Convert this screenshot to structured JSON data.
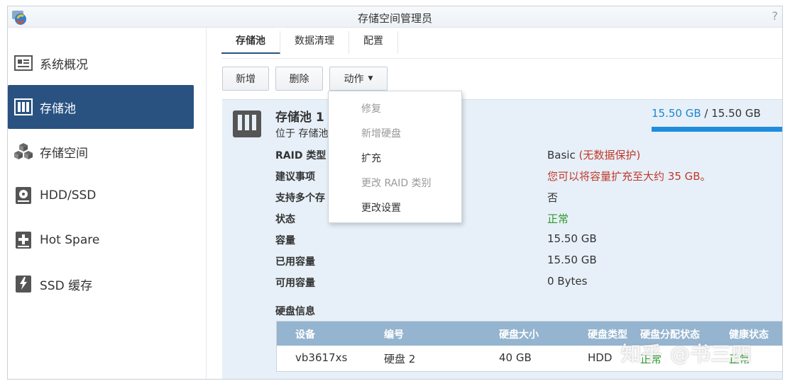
{
  "window": {
    "title": "存储空间管理员",
    "help": "?"
  },
  "sidebar": {
    "items": [
      {
        "label": "系统概况",
        "icon": "overview-icon"
      },
      {
        "label": "存储池",
        "icon": "storage-pool-icon",
        "active": true
      },
      {
        "label": "存储空间",
        "icon": "volume-icon"
      },
      {
        "label": "HDD/SSD",
        "icon": "hdd-icon"
      },
      {
        "label": "Hot Spare",
        "icon": "hot-spare-icon"
      },
      {
        "label": "SSD 缓存",
        "icon": "ssd-cache-icon"
      }
    ]
  },
  "tabs": [
    "存储池",
    "数据清理",
    "配置"
  ],
  "toolbar": {
    "add": "新增",
    "delete": "删除",
    "action": "动作"
  },
  "action_menu": {
    "items": [
      {
        "label": "修复",
        "enabled": false
      },
      {
        "label": "新增硬盘",
        "enabled": false
      },
      {
        "label": "扩充",
        "enabled": true
      },
      {
        "label": "更改 RAID 类别",
        "enabled": false
      },
      {
        "label": "更改设置",
        "enabled": true
      }
    ]
  },
  "pool": {
    "title": "存储池 1",
    "subtitle": "位于 存储池",
    "capacity_used": "15.50 GB",
    "capacity_sep": " / ",
    "capacity_total": "15.50 GB",
    "usage_fraction": 1.0,
    "rows": [
      {
        "label": "RAID 类型",
        "value": "Basic",
        "extra": "(无数据保护)"
      },
      {
        "label": "建议事项",
        "value": "您可以将容量扩充至大约 35 GB。"
      },
      {
        "label": "支持多个存",
        "value": "否"
      },
      {
        "label": "状态",
        "value": "正常"
      },
      {
        "label": "容量",
        "value": "15.50 GB"
      },
      {
        "label": "已用容量",
        "value": "15.50 GB"
      },
      {
        "label": "可用容量",
        "value": "0 Bytes"
      }
    ],
    "disk_info_title": "硬盘信息",
    "disk_table": {
      "headers": [
        "设备",
        "编号",
        "硬盘大小",
        "硬盘类型",
        "硬盘分配状态",
        "健康状态"
      ],
      "rows": [
        [
          "vb3617xs",
          "硬盘 2",
          "40 GB",
          "HDD",
          "正常",
          "正常"
        ]
      ]
    }
  },
  "watermark": "知乎 @书三四",
  "colors": {
    "accent": "#2a5281",
    "progress": "#1f8ddd",
    "ok": "#2e9a2e",
    "warn": "#c0392b"
  }
}
